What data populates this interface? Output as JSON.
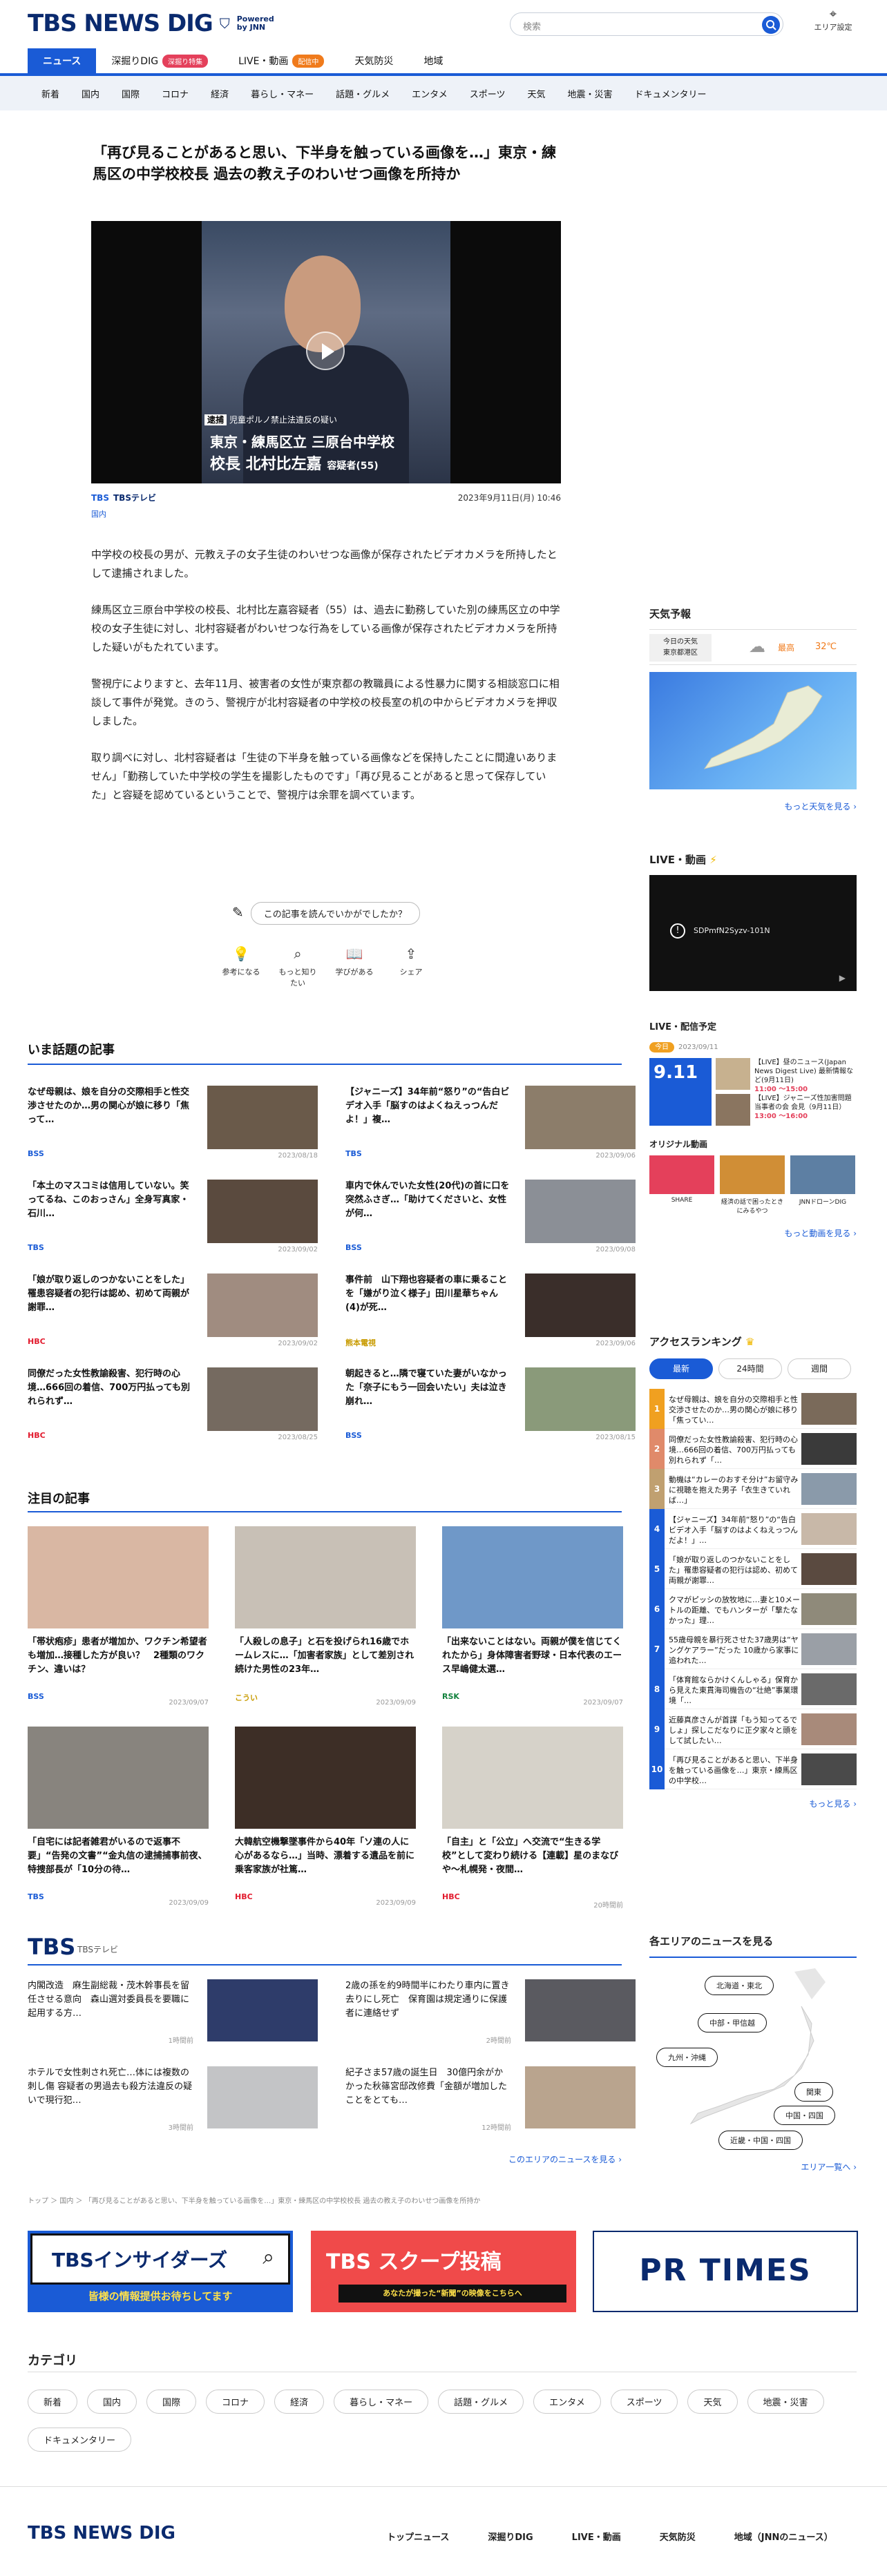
{
  "header": {
    "logo": "TBS NEWS DIG",
    "logo_sub1": "Powered",
    "logo_sub2": "by JNN",
    "search_placeholder": "検索",
    "area_label": "エリア設定"
  },
  "tabs": [
    {
      "label": "ニュース",
      "badge": ""
    },
    {
      "label": "深掘りDIG",
      "badge": "深掘り特集"
    },
    {
      "label": "LIVE・動画",
      "badge": "配信中"
    },
    {
      "label": "天気防災",
      "badge": ""
    },
    {
      "label": "地域",
      "badge": ""
    }
  ],
  "subnav": [
    "新着",
    "国内",
    "国際",
    "コロナ",
    "経済",
    "暮らし・マネー",
    "話題・グルメ",
    "エンタメ",
    "スポーツ",
    "天気",
    "地震・災害",
    "ドキュメンタリー"
  ],
  "article": {
    "headline": "「再び見ることがあると思い、下半身を触っている画像を…」東京・練馬区の中学校校長 過去の教え子のわいせつ画像を所持か",
    "video_tag": "逮捕",
    "video_tag_text": "児童ポルノ禁止法違反の疑い",
    "video_line1": "東京・練馬区立 三原台中学校",
    "video_line2_prefix": "校長 北村比左嘉",
    "video_line2_suffix": "容疑者(55)",
    "source": "TBSテレビ",
    "date": "2023年9月11日(月) 10:46",
    "category": "国内",
    "paragraphs": [
      "中学校の校長の男が、元教え子の女子生徒のわいせつな画像が保存されたビデオカメラを所持したとして逮捕されました。",
      "練馬区立三原台中学校の校長、北村比左嘉容疑者（55）は、過去に勤務していた別の練馬区立の中学校の女子生徒に対し、北村容疑者がわいせつな行為をしている画像が保存されたビデオカメラを所持した疑いがもたれています。",
      "警視庁によりますと、去年11月、被害者の女性が東京都の教職員による性暴力に関する相談窓口に相談して事件が発覚。きのう、警視庁が北村容疑者の中学校の校長室の机の中からビデオカメラを押収しました。",
      "取り調べに対し、北村容疑者は「生徒の下半身を触っている画像などを保持したことに間違いありません」「勤務していた中学校の学生を撮影したものです」「再び見ることがあると思って保存していた」と容疑を認めているということで、警視庁は余罪を調べています。"
    ],
    "feedback_question": "この記事を読んでいかがでしたか？",
    "feedback_options": [
      "参考になる",
      "もっと知りたい",
      "学びがある",
      "シェア"
    ]
  },
  "trending": {
    "title": "いま話題の記事",
    "items": [
      {
        "title": "なぜ母親は、娘を自分の交際相手と性交渉させたのか…男の関心が娘に移り「焦って…",
        "source": "BSS",
        "date": "2023/08/18"
      },
      {
        "title": "【ジャニーズ】34年前“怒り”の“告白ビデオ入手「脳すのはよくねえっつんだよ！」複…",
        "source": "TBS",
        "date": "2023/09/06"
      },
      {
        "title": "「本土のマスコミは信用していない。笑ってるね、このおっさん」全身写真家・石川…",
        "source": "TBS",
        "date": "2023/09/02"
      },
      {
        "title": "車内で休んでいた女性(20代)の首に口を突然ふさぎ…「助けてくださいと、女性が何…",
        "source": "BSS",
        "date": "2023/09/08"
      },
      {
        "title": "「娘が取り返しのつかないことをした」罹患容疑者の犯行は認め、初めて両親が謝罪…",
        "source": "HBC",
        "date": "2023/09/02"
      },
      {
        "title": "事件前　山下翔也容疑者の車に乗ることを「嫌がり泣く様子」田川星華ちゃん(4)が死…",
        "source": "熊本電視",
        "date": "2023/09/06"
      },
      {
        "title": "同僚だった女性教諭殺害、犯行時の心境…666回の着信、700万円払っても別れられず…",
        "source": "HBC",
        "date": "2023/08/25"
      },
      {
        "title": "朝起きると…隣で寝ていた妻がいなかった「奈子にもう一回会いたい」夫は泣き崩れ…",
        "source": "BSS",
        "date": "2023/08/15"
      }
    ]
  },
  "featured": {
    "title": "注目の記事",
    "items": [
      {
        "title": "「帯状疱疹」患者が増加か、ワクチン希望者も増加…接種した方が良い？　2種類のワクチン、違いは？",
        "source": "BSS",
        "date": "2023/09/07"
      },
      {
        "title": "「人殺しの息子」と石を投げられ16歳でホームレスに…「加害者家族」として差別され続けた男性の23年…",
        "source": "こうい",
        "date": "2023/09/09"
      },
      {
        "title": "「出来ないことはない。両親が僕を信じてくれたから」身体障害者野球・日本代表のエース早嶋健太選…",
        "source": "RSK",
        "date": "2023/09/07"
      },
      {
        "title": "「自宅には記者雑君がいるので返事不要」“告発の文書”“金丸信の逮捕捕事前夜、特捜部長が「10分の待…",
        "source": "TBS",
        "date": "2023/09/09"
      },
      {
        "title": "大韓航空機撃墜事件から40年「ソ連の人に心があるなら…」当時、漂着する遺品を前に乗客家族が社篤…",
        "source": "HBC",
        "date": "2023/09/09"
      },
      {
        "title": "「自主」と「公立」へ交流で“生きる学校”として変わり続ける【連載】星のまなびや～札幌発・夜間…",
        "source": "HBC",
        "date": "20時間前"
      }
    ]
  },
  "tbs_section": {
    "logo": "TBS",
    "label": "TBSテレビ",
    "items": [
      {
        "title": "内閣改造　麻生副総裁・茂木幹事長を留任させる意向　森山選対委員長を要職に起用する方…",
        "date": "1時間前"
      },
      {
        "title": "2歳の孫を約9時間半にわたり車内に置き去りにし死亡　保育園は規定通りに保護者に連絡せず",
        "date": "2時間前"
      },
      {
        "title": "ホテルで女性刺され死亡…体には複数の刺し傷 容疑者の男過去も殺方法違反の疑いで現行犯…",
        "date": "3時間前"
      },
      {
        "title": "紀子さま57歳の誕生日　30億円余がかかった秋篠宮邸改修費「金額が増加したことをとても…",
        "date": "12時間前"
      }
    ],
    "more": "このエリアのニュースを見る ›"
  },
  "breadcrumb": "トップ ＞ 国内 ＞ 「再び見ることがあると思い、下半身を触っている画像を…」東京・練馬区の中学校校長 過去の教え子のわいせつ画像を所持か",
  "banners": [
    {
      "title": "TBSインサイダーズ",
      "sub": "皆様の情報提供お待ちしてます"
    },
    {
      "title": "TBS スクープ投稿",
      "sub": "あなたが撮った“新聞”の映像をこちらへ"
    },
    {
      "title": "PR TIMES",
      "sub": ""
    }
  ],
  "categories": {
    "title": "カテゴリ",
    "items": [
      "新着",
      "国内",
      "国際",
      "コロナ",
      "経済",
      "暮らし・マネー",
      "話題・グルメ",
      "エンタメ",
      "スポーツ",
      "天気",
      "地震・災害",
      "ドキュメンタリー"
    ]
  },
  "sidebar": {
    "weather_title": "天気予報",
    "weather_today": "今日の天気",
    "weather_place": "東京都港区",
    "weather_high_label": "最高",
    "weather_high": "32℃",
    "weather_more": "もっと天気を見る ›",
    "live_title": "LIVE・動画",
    "live_video_id": "SDPmfN2Syzv-101N",
    "schedule_title": "LIVE・配信予定",
    "schedule_today": "今日",
    "schedule_date": "2023/09/11",
    "schedule_day": "9.11",
    "schedule_items": [
      {
        "title": "【LIVE】昼のニュース(Japan News Digest Live) 最新情報など(9月11日)",
        "time": "11:00 ～15:00"
      },
      {
        "title": "【LIVE】ジャニーズ性加害問題 当事者の会 会見（9月11日）",
        "time": "13:00 ～16:00"
      }
    ],
    "original_title": "オリジナル動画",
    "original_items": [
      "SHARE",
      "経済の話で困ったときにみるやつ",
      "JNNドローンDIG"
    ],
    "original_more": "もっと動画を見る ›",
    "ranking_title": "アクセスランキング",
    "ranking_tabs": [
      "最新",
      "24時間",
      "週間"
    ],
    "ranking": [
      "なぜ母親は、娘を自分の交際相手と性交渉させたのか…男の関心が娘に移り「焦ってい…",
      "同僚だった女性教諭殺害、犯行時の心境…666回の着信、700万円払っても別れられず「…",
      "動機は“カレーのおすそ分け”お留守みに視聴を抱えた男子「衣生きていれば…」",
      "【ジャニーズ】34年前“怒り”の“告白ビデオ入手「脳すのはよくねえっつんだよ！」…",
      "「娘が取り返しのつかないことをした」罹患容疑者の犯行は認め、初めて両親が謝罪…",
      "クマがピッシの放牧地に…妻と10メートルの距離、でもハンターが「撃たなかった」理…",
      "55歳母親を暴行死させた37歳男は“ヤングケアラー”だった 10歳から家事に追われた…",
      "「体育館ならかけくんしゃる」保育から見えた東貫海司機告の“壮絶”事業環境「…",
      "近藤真彦さんが首謀「もう知ってるでしょ」探しこだなりに正夕家々と頭をして試したい…",
      "「再び見ることがあると思い、下半身を触っている画像を…」東京・練馬区の中学校…"
    ],
    "ranking_more": "もっと見る ›",
    "area_title": "各エリアのニュースを見る",
    "areas": [
      "北海道・東北",
      "中部・甲信越",
      "九州・沖縄",
      "関東",
      "中国・四国",
      "近畿・中国・四国"
    ],
    "area_more": "エリア一覧へ ›"
  },
  "footer": {
    "nav": [
      "トップニュース",
      "深掘りDIG",
      "LIVE・動画",
      "天気防災",
      "地域（JNNのニュース）"
    ]
  }
}
